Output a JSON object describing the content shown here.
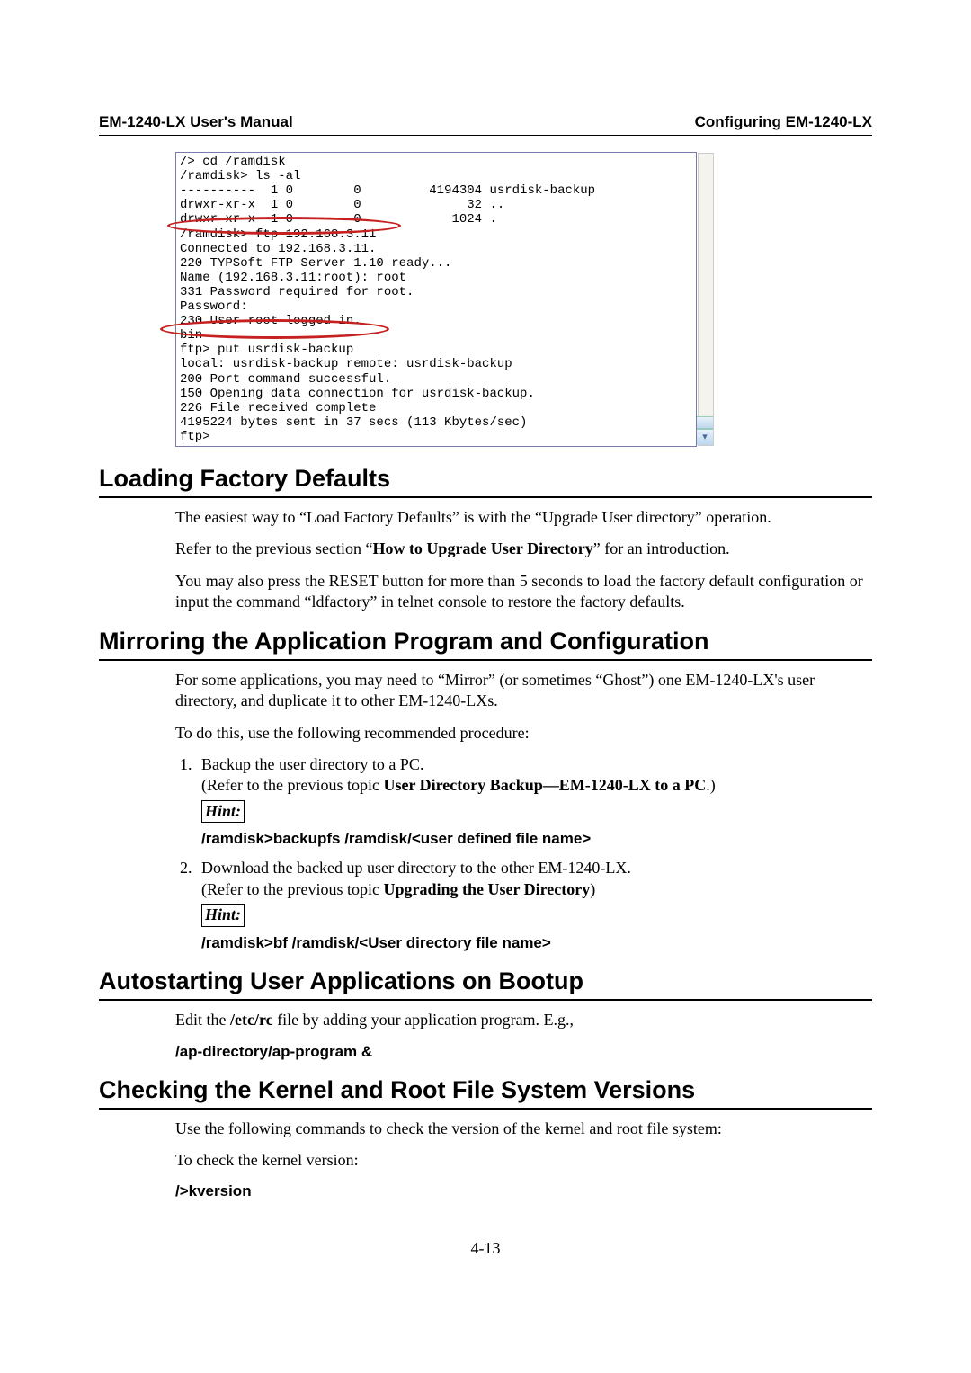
{
  "header": {
    "left": "EM-1240-LX User's Manual",
    "right": "Configuring EM-1240-LX"
  },
  "terminal": {
    "text": "/> cd /ramdisk\n/ramdisk> ls -al\n----------  1 0        0         4194304 usrdisk-backup\ndrwxr-xr-x  1 0        0              32 ..\ndrwxr-xr-x  1 0        0            1024 .\n/ramdisk> ftp 192.168.3.11\nConnected to 192.168.3.11.\n220 TYPSoft FTP Server 1.10 ready...\nName (192.168.3.11:root): root\n331 Password required for root.\nPassword:\n230 User root logged in.\nbin\nftp> put usrdisk-backup\nlocal: usrdisk-backup remote: usrdisk-backup\n200 Port command successful.\n150 Opening data connection for usrdisk-backup.\n226 File received complete\n4195224 bytes sent in 37 secs (113 Kbytes/sec)\nftp>"
  },
  "sections": {
    "loading": {
      "title": "Loading Factory Defaults",
      "p1_a": "The easiest way to “Load Factory Defaults” is with the “Upgrade User directory” operation.",
      "p2_a": "Refer to the previous section “",
      "p2_b": "How to Upgrade User Directory",
      "p2_c": "” for an introduction.",
      "p3": "You may also press the RESET button for more than 5 seconds to load the factory default configuration or input the command “ldfactory” in telnet console to restore the factory defaults."
    },
    "mirroring": {
      "title": "Mirroring the Application Program and Configuration",
      "p1": "For some applications, you may need to “Mirror” (or sometimes “Ghost”) one EM-1240-LX's user directory, and duplicate it to other EM-1240-LXs.",
      "p2": "To do this, use the following recommended procedure:",
      "step1_a": "Backup the user directory to a PC.",
      "step1_b": "(Refer to the previous topic ",
      "step1_c": "User Directory Backup—EM-1240-LX to a PC",
      "step1_d": ".)",
      "hint_label": "Hint:",
      "hint1_cmd": "/ramdisk>backupfs /ramdisk/<user defined file name>",
      "step2_a": "Download the backed up user directory to the other EM-1240-LX.",
      "step2_b": "(Refer to the previous topic ",
      "step2_c": "Upgrading the User Directory",
      "step2_d": ")",
      "hint2_cmd": "/ramdisk>bf /ramdisk/<User directory file name>"
    },
    "autostart": {
      "title": "Autostarting User Applications on Bootup",
      "p1_a": "Edit the ",
      "p1_b": "/etc/rc",
      "p1_c": " file by adding your application program. E.g.,",
      "cmd": "/ap-directory/ap-program &"
    },
    "checking": {
      "title": "Checking the Kernel and Root File System Versions",
      "p1": "Use the following commands to check the version of the kernel and root file system:",
      "p2": "To check the kernel version:",
      "cmd": "/>kversion"
    }
  },
  "page_number": "4-13"
}
